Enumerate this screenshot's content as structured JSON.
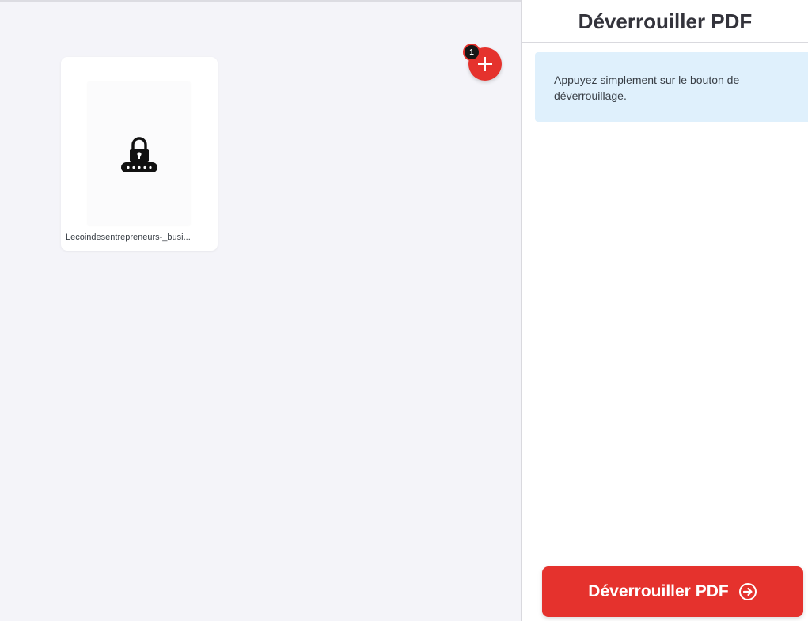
{
  "workspace": {
    "files": [
      {
        "name": "Lecoindesentrepreneurs-_busi...",
        "icon": "lock-password-icon"
      }
    ],
    "file_count": "1",
    "add_icon": "plus-icon"
  },
  "panel": {
    "title": "Déverrouiller PDF",
    "info_text": "Appuyez simplement sur le bouton de déverrouillage.",
    "action_label": "Déverrouiller PDF",
    "action_icon": "arrow-right-circle-icon"
  },
  "colors": {
    "accent": "#e5322d",
    "info_bg": "#dff0fc",
    "workspace_bg": "#f4f4f9",
    "badge_bg": "#161616"
  }
}
